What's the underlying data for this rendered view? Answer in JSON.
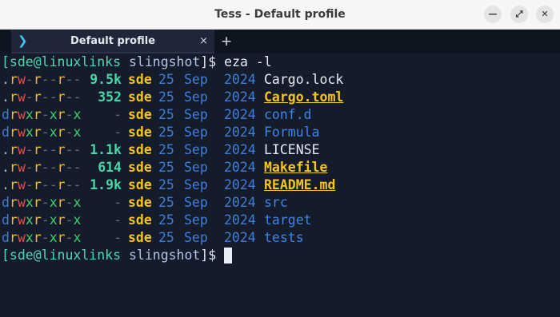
{
  "window": {
    "title": "Tess - Default profile",
    "minimize_icon": "minimize-icon",
    "maximize_icon": "maximize-icon",
    "close_icon": "close-icon"
  },
  "tab": {
    "label": "Default profile",
    "icon": "terminal-prompt-icon",
    "close_glyph": "×",
    "new_tab_glyph": "+"
  },
  "terminal": {
    "prompt": {
      "user_host": "[sde@linuxlinks",
      "dir": "slingshot",
      "suffix": "]$"
    },
    "command": "eza -l",
    "listing": [
      {
        "type": ".",
        "perms": "rw-r--r--",
        "size": "9.5k",
        "user": "sde",
        "day": "25",
        "month": "Sep",
        "year": "2024",
        "name": "Cargo.lock",
        "kind": "file"
      },
      {
        "type": ".",
        "perms": "rw-r--r--",
        "size": "352",
        "user": "sde",
        "day": "25",
        "month": "Sep",
        "year": "2024",
        "name": "Cargo.toml",
        "kind": "build"
      },
      {
        "type": "d",
        "perms": "rwxr-xr-x",
        "size": "-",
        "user": "sde",
        "day": "25",
        "month": "Sep",
        "year": "2024",
        "name": "conf.d",
        "kind": "dir"
      },
      {
        "type": "d",
        "perms": "rwxr-xr-x",
        "size": "-",
        "user": "sde",
        "day": "25",
        "month": "Sep",
        "year": "2024",
        "name": "Formula",
        "kind": "dir"
      },
      {
        "type": ".",
        "perms": "rw-r--r--",
        "size": "1.1k",
        "user": "sde",
        "day": "25",
        "month": "Sep",
        "year": "2024",
        "name": "LICENSE",
        "kind": "file"
      },
      {
        "type": ".",
        "perms": "rw-r--r--",
        "size": "614",
        "user": "sde",
        "day": "25",
        "month": "Sep",
        "year": "2024",
        "name": "Makefile",
        "kind": "build"
      },
      {
        "type": ".",
        "perms": "rw-r--r--",
        "size": "1.9k",
        "user": "sde",
        "day": "25",
        "month": "Sep",
        "year": "2024",
        "name": "README.md",
        "kind": "build"
      },
      {
        "type": "d",
        "perms": "rwxr-xr-x",
        "size": "-",
        "user": "sde",
        "day": "25",
        "month": "Sep",
        "year": "2024",
        "name": "src",
        "kind": "dir"
      },
      {
        "type": "d",
        "perms": "rwxr-xr-x",
        "size": "-",
        "user": "sde",
        "day": "25",
        "month": "Sep",
        "year": "2024",
        "name": "target",
        "kind": "dir"
      },
      {
        "type": "d",
        "perms": "rwxr-xr-x",
        "size": "-",
        "user": "sde",
        "day": "25",
        "month": "Sep",
        "year": "2024",
        "name": "tests",
        "kind": "dir"
      }
    ]
  },
  "colors": {
    "background": "#141b2b",
    "prompt_user": "#4fd6b0",
    "directory": "#3b86e6",
    "highlight_file": "#f5c518",
    "size": "#48d6a6"
  }
}
